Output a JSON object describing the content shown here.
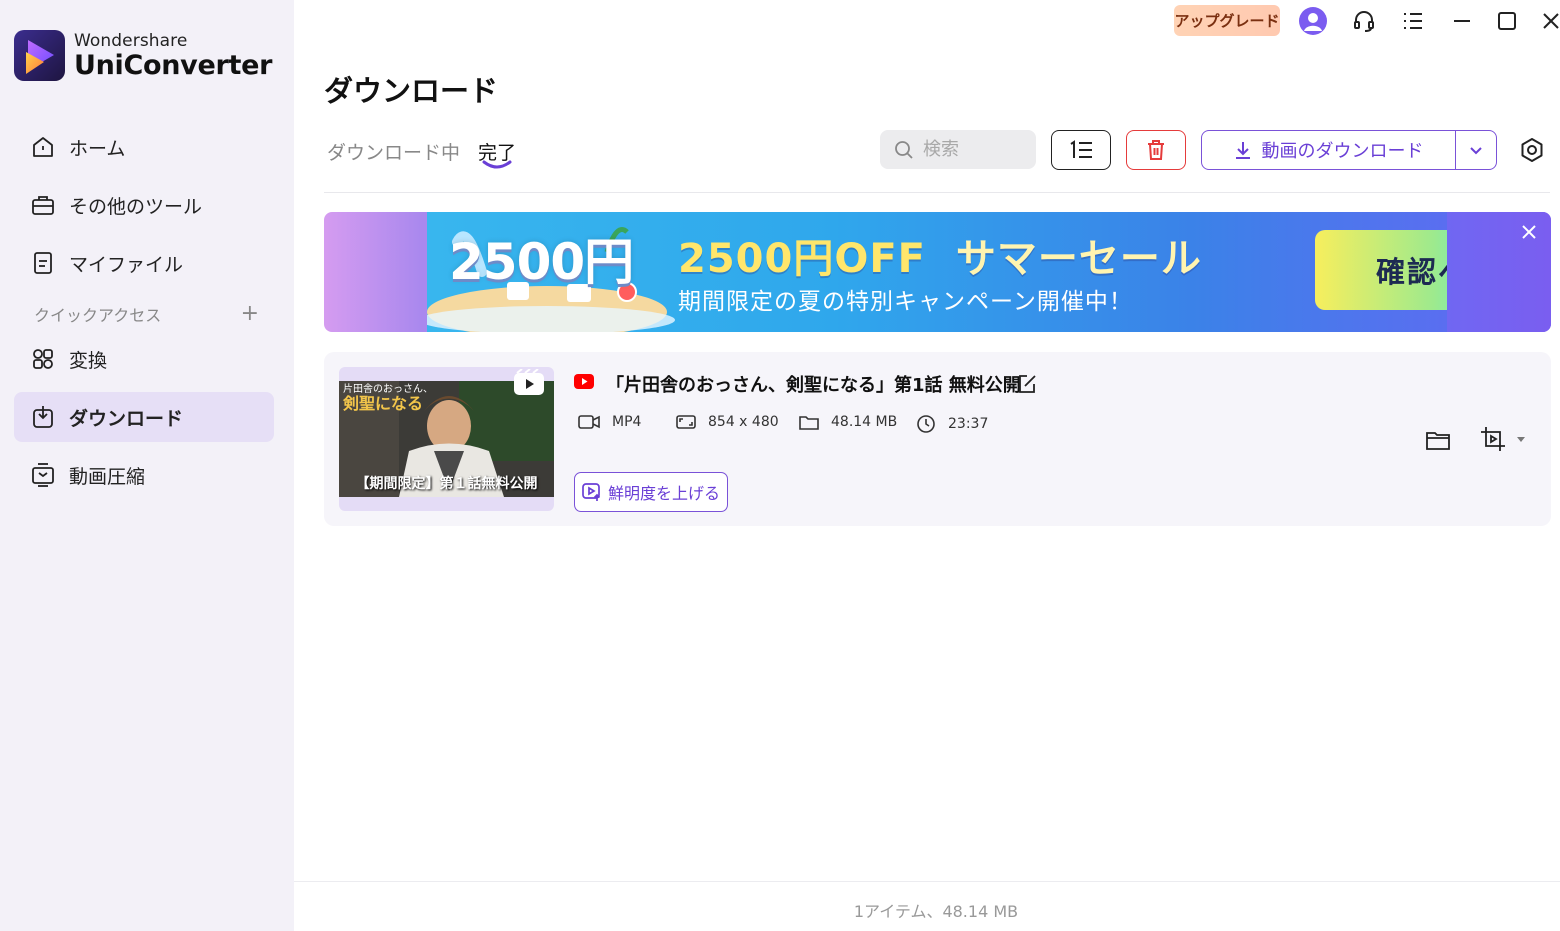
{
  "app": {
    "brand": "Wondershare",
    "product": "UniConverter"
  },
  "topbar": {
    "upgrade_label": "アップグレード",
    "icons": [
      "avatar-icon",
      "headset-icon",
      "menu-list-icon",
      "minimize-icon",
      "maximize-icon",
      "close-icon"
    ]
  },
  "sidebar": {
    "items": [
      {
        "label": "ホーム",
        "icon": "home-icon"
      },
      {
        "label": "その他のツール",
        "icon": "toolbox-icon"
      },
      {
        "label": "マイファイル",
        "icon": "file-icon"
      }
    ],
    "quick_access_label": "クイックアクセス",
    "quick_access_add": "+",
    "quick_items": [
      {
        "label": "変換",
        "icon": "convert-icon"
      },
      {
        "label": "ダウンロード",
        "icon": "download-icon",
        "active": true
      },
      {
        "label": "動画圧縮",
        "icon": "compress-icon"
      }
    ]
  },
  "main": {
    "title": "ダウンロード",
    "tabs": [
      {
        "label": "ダウンロード中",
        "active": false
      },
      {
        "label": "完了",
        "active": true
      }
    ],
    "search": {
      "placeholder": "検索",
      "value": ""
    },
    "download_button_label": "動画のダウンロード"
  },
  "banner": {
    "big_text": "2500円",
    "title_accent": "2500円OFF",
    "title_rest": "サマーセール",
    "subtitle": "期間限定の夏の特別キャンペーン開催中！",
    "cta": "確認へ"
  },
  "items": [
    {
      "title": "「片田舎のおっさん、剣聖になる」第1話 無料公開",
      "format": "MP4",
      "resolution": "854 x 480",
      "size": "48.14 MB",
      "duration": "23:37",
      "thumb_caption": "【期間限定】第１話無料公開",
      "thumb_top_line1": "片田舎のおっさん、",
      "thumb_top_line2": "剣聖になる",
      "enhance_label": "鮮明度を上げる"
    }
  ],
  "footer": {
    "summary": "1アイテム、48.14 MB"
  },
  "colors": {
    "accent": "#6a3fd6",
    "sidebar_bg": "#f3f1f8",
    "active_nav": "#e6dff6",
    "danger": "#e53b3b"
  }
}
